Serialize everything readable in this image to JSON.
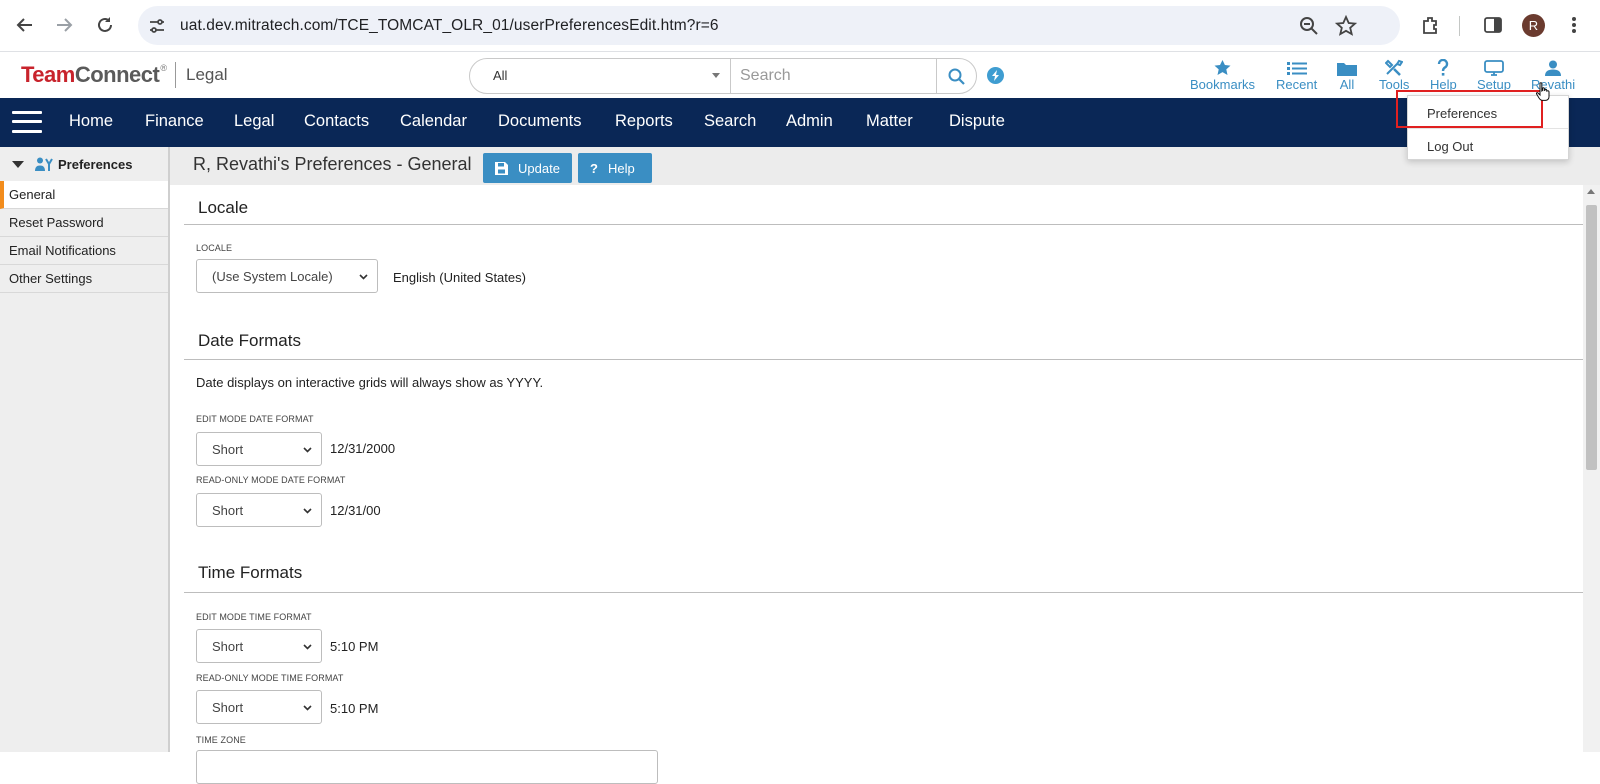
{
  "browser": {
    "url": "uat.dev.mitratech.com/TCE_TOMCAT_OLR_01/userPreferencesEdit.htm?r=6",
    "profile_initial": "R"
  },
  "app": {
    "logo_team": "Team",
    "logo_connect": "Connect",
    "logo_reg": "®",
    "logo_product": "Legal",
    "search_scope": "All",
    "search_placeholder": "Search",
    "top_icons": [
      {
        "label": "Bookmarks",
        "icon": "star-icon"
      },
      {
        "label": "Recent",
        "icon": "list-icon"
      },
      {
        "label": "All",
        "icon": "folder-icon"
      },
      {
        "label": "Tools",
        "icon": "tools-icon"
      },
      {
        "label": "Help",
        "icon": "question-icon"
      },
      {
        "label": "Setup",
        "icon": "monitor-icon"
      },
      {
        "label": "Revathi",
        "icon": "user-icon"
      }
    ],
    "user_menu": [
      "Preferences",
      "Log Out"
    ]
  },
  "nav": [
    "Home",
    "Finance",
    "Legal",
    "Contacts",
    "Calendar",
    "Documents",
    "Reports",
    "Search",
    "Admin",
    "Matter",
    "Dispute"
  ],
  "sidebar": {
    "header": "Preferences",
    "items": [
      "General",
      "Reset Password",
      "Email Notifications",
      "Other Settings"
    ]
  },
  "page": {
    "title": "R, Revathi's Preferences - General",
    "update_label": "Update",
    "help_label": "Help",
    "locale": {
      "section": "Locale",
      "label": "LOCALE",
      "value": "(Use System Locale)",
      "resolved": "English (United States)"
    },
    "date": {
      "section": "Date Formats",
      "note": "Date displays on interactive grids will always show as YYYY.",
      "edit_label": "EDIT MODE DATE FORMAT",
      "edit_value": "Short",
      "edit_example": "12/31/2000",
      "ro_label": "READ-ONLY MODE DATE FORMAT",
      "ro_value": "Short",
      "ro_example": "12/31/00"
    },
    "time": {
      "section": "Time Formats",
      "edit_label": "EDIT MODE TIME FORMAT",
      "edit_value": "Short",
      "edit_example": "5:10 PM",
      "ro_label": "READ-ONLY MODE TIME FORMAT",
      "ro_value": "Short",
      "ro_example": "5:10 PM",
      "tz_label": "TIME ZONE"
    }
  },
  "colors": {
    "navbar": "#0a2756",
    "accent": "#3a8ec3",
    "active_marker": "#f28c1c",
    "highlight": "#e02020"
  }
}
